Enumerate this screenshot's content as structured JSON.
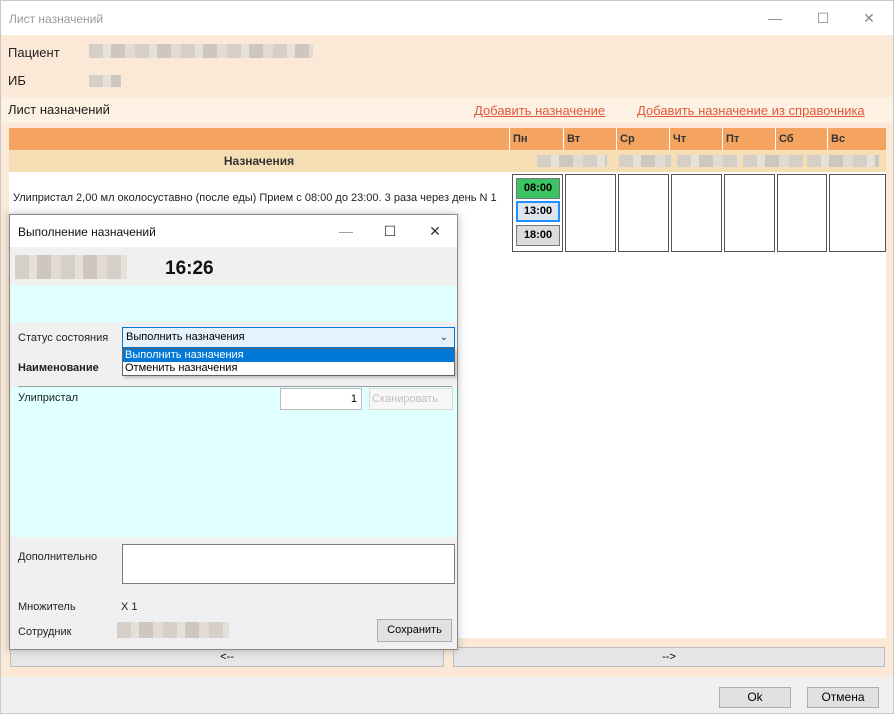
{
  "window": {
    "title": "Лист назначений",
    "minimize_icon": "minimize-icon",
    "maximize_icon": "maximize-icon",
    "close_icon": "close-icon"
  },
  "patient": {
    "patient_label": "Пациент",
    "ib_label": "ИБ"
  },
  "list": {
    "heading": "Лист назначений",
    "add_link": "Добавить назначение",
    "add_from_ref_link": "Добавить назначение из справочника",
    "column_title": "Назначения",
    "days": [
      "Пн",
      "Вт",
      "Ср",
      "Чт",
      "Пт",
      "Сб",
      "Вс"
    ],
    "row": {
      "text": "Улипристал 2,00 мл  околосуставно (после еды)   Прием с 08:00 до 23:00. 3 раза через день N 1",
      "times": [
        "08:00",
        "13:00",
        "18:00"
      ]
    }
  },
  "nav": {
    "prev": "<--",
    "next": "-->"
  },
  "footer": {
    "ok": "Ok",
    "cancel": "Отмена"
  },
  "dialog": {
    "title": "Выполнение назначений",
    "time": "16:26",
    "status_label": "Статус состояния",
    "status_value": "Выполнить назначения",
    "status_options": [
      "Выполнить назначения",
      "Отменить назначения"
    ],
    "name_label": "Наименование",
    "drug_name": "Улипристал",
    "quantity": "1",
    "scan_button": "Сканировать",
    "additional_label": "Дополнительно",
    "multiplier_label": "Множитель",
    "multiplier_value": "X 1",
    "employee_label": "Сотрудник",
    "save_button": "Сохранить"
  },
  "colors": {
    "header_orange": "#f4a460",
    "subheader_wheat": "#f5deb3",
    "content_bg": "#fbe8d6",
    "link": "#e05a3a",
    "time_green": "#3cc464",
    "selection_blue": "#0078d7",
    "cyan_panel": "#e0ffff"
  }
}
